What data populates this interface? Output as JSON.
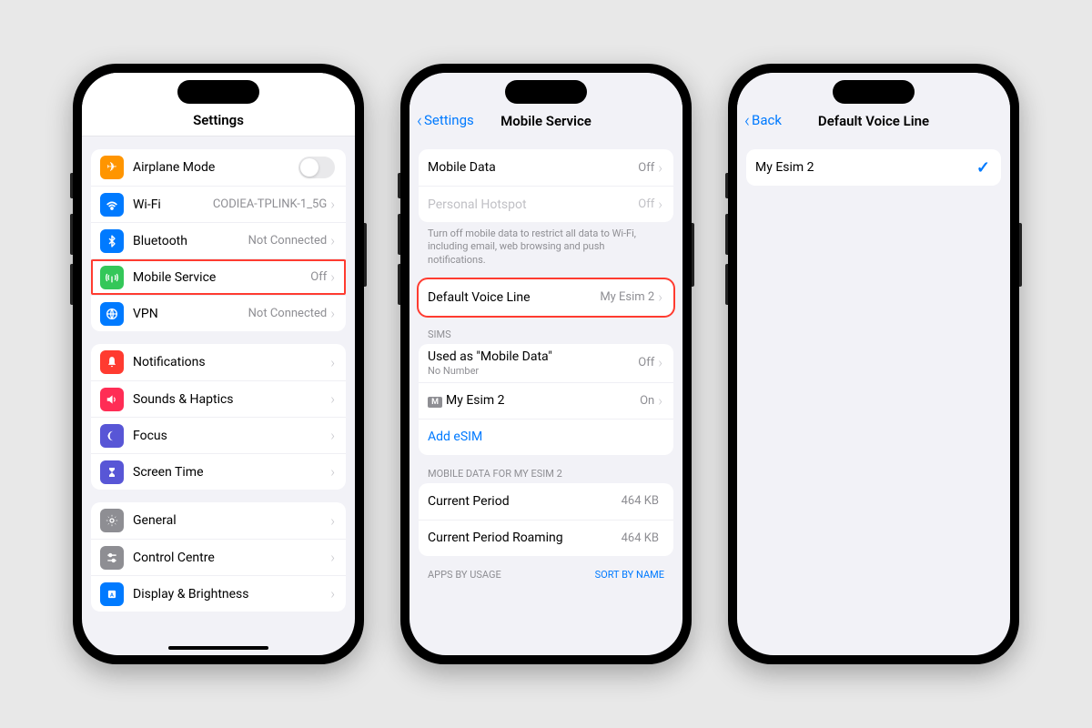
{
  "phone1": {
    "title": "Settings",
    "rows": {
      "airplane": {
        "label": "Airplane Mode"
      },
      "wifi": {
        "label": "Wi-Fi",
        "value": "CODIEA-TPLINK-1_5G"
      },
      "bluetooth": {
        "label": "Bluetooth",
        "value": "Not Connected"
      },
      "mobile": {
        "label": "Mobile Service",
        "value": "Off"
      },
      "vpn": {
        "label": "VPN",
        "value": "Not Connected"
      },
      "notifications": {
        "label": "Notifications"
      },
      "sounds": {
        "label": "Sounds & Haptics"
      },
      "focus": {
        "label": "Focus"
      },
      "screentime": {
        "label": "Screen Time"
      },
      "general": {
        "label": "General"
      },
      "controlcentre": {
        "label": "Control Centre"
      },
      "display": {
        "label": "Display & Brightness"
      }
    }
  },
  "phone2": {
    "back": "Settings",
    "title": "Mobile Service",
    "rows": {
      "mobiledata": {
        "label": "Mobile Data",
        "value": "Off"
      },
      "hotspot": {
        "label": "Personal Hotspot",
        "value": "Off"
      },
      "footer": "Turn off mobile data to restrict all data to Wi-Fi, including email, web browsing and push notifications.",
      "voiceline": {
        "label": "Default Voice Line",
        "value": "My Esim 2"
      },
      "sims_header": "SIMs",
      "sim1": {
        "label": "Used as \"Mobile Data\"",
        "sub": "No Number",
        "value": "Off"
      },
      "sim2": {
        "label": "My Esim 2",
        "value": "On",
        "badge": "M"
      },
      "addesim": "Add eSIM",
      "usage_header": "MOBILE DATA FOR MY ESIM 2",
      "current": {
        "label": "Current Period",
        "value": "464 KB"
      },
      "roaming": {
        "label": "Current Period Roaming",
        "value": "464 KB"
      },
      "apps_header": "APPS BY USAGE",
      "sort": "SORT BY NAME"
    }
  },
  "phone3": {
    "back": "Back",
    "title": "Default Voice Line",
    "rows": {
      "esim2": {
        "label": "My Esim 2"
      }
    }
  }
}
